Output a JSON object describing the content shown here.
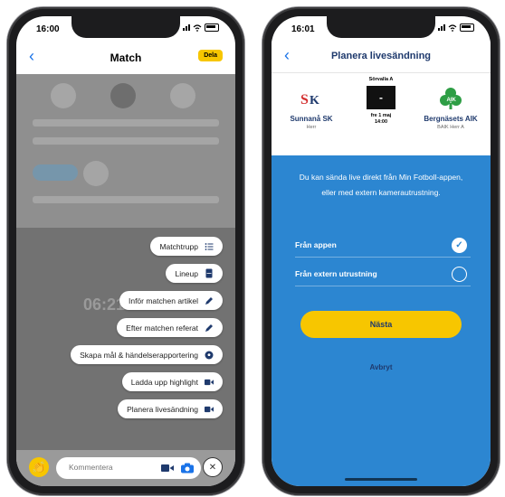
{
  "left_phone": {
    "status": {
      "time": "16:00"
    },
    "nav": {
      "title": "Match",
      "share_label": "Dela"
    },
    "background": {
      "teams": [
        "Sunnanå SK",
        "Bergnäsets AIK"
      ],
      "timer": "06:21"
    },
    "menu": {
      "items": [
        {
          "label": "Matchtrupp",
          "icon": "list-icon"
        },
        {
          "label": "Lineup",
          "icon": "lineup-icon"
        },
        {
          "label": "Inför matchen artikel",
          "icon": "pencil-icon"
        },
        {
          "label": "Efter matchen referat",
          "icon": "pencil-icon"
        },
        {
          "label": "Skapa mål & händelserapportering",
          "icon": "soccer-ball-icon"
        },
        {
          "label": "Ladda upp highlight",
          "icon": "video-icon"
        },
        {
          "label": "Planera livesändning",
          "icon": "video-icon"
        }
      ]
    },
    "bottom": {
      "comment_placeholder": "Kommentera",
      "icons": [
        "clap-emoji-icon",
        "video-camera-icon",
        "camera-icon",
        "close-icon"
      ]
    }
  },
  "right_phone": {
    "status": {
      "time": "16:01"
    },
    "nav": {
      "title": "Planera livesändning"
    },
    "match": {
      "home": {
        "name": "Sunnanå SK",
        "sub": "Herr"
      },
      "away": {
        "name": "Bergnäsets AIK",
        "sub": "BAIK Herr A"
      },
      "venue": "Sörvalla A",
      "score": "-",
      "date_line1": "fre 1 maj",
      "date_line2": "14:00"
    },
    "info_text": "Du kan sända live direkt från Min Fotboll-appen, eller med extern kamerautrustning.",
    "options": [
      {
        "label": "Från appen",
        "selected": true
      },
      {
        "label": "Från extern utrustning",
        "selected": false
      }
    ],
    "next_label": "Nästa",
    "cancel_label": "Avbryt"
  },
  "colors": {
    "accent_yellow": "#f7c600",
    "primary_blue": "#2c86d1",
    "navy_text": "#1f3a6d"
  }
}
